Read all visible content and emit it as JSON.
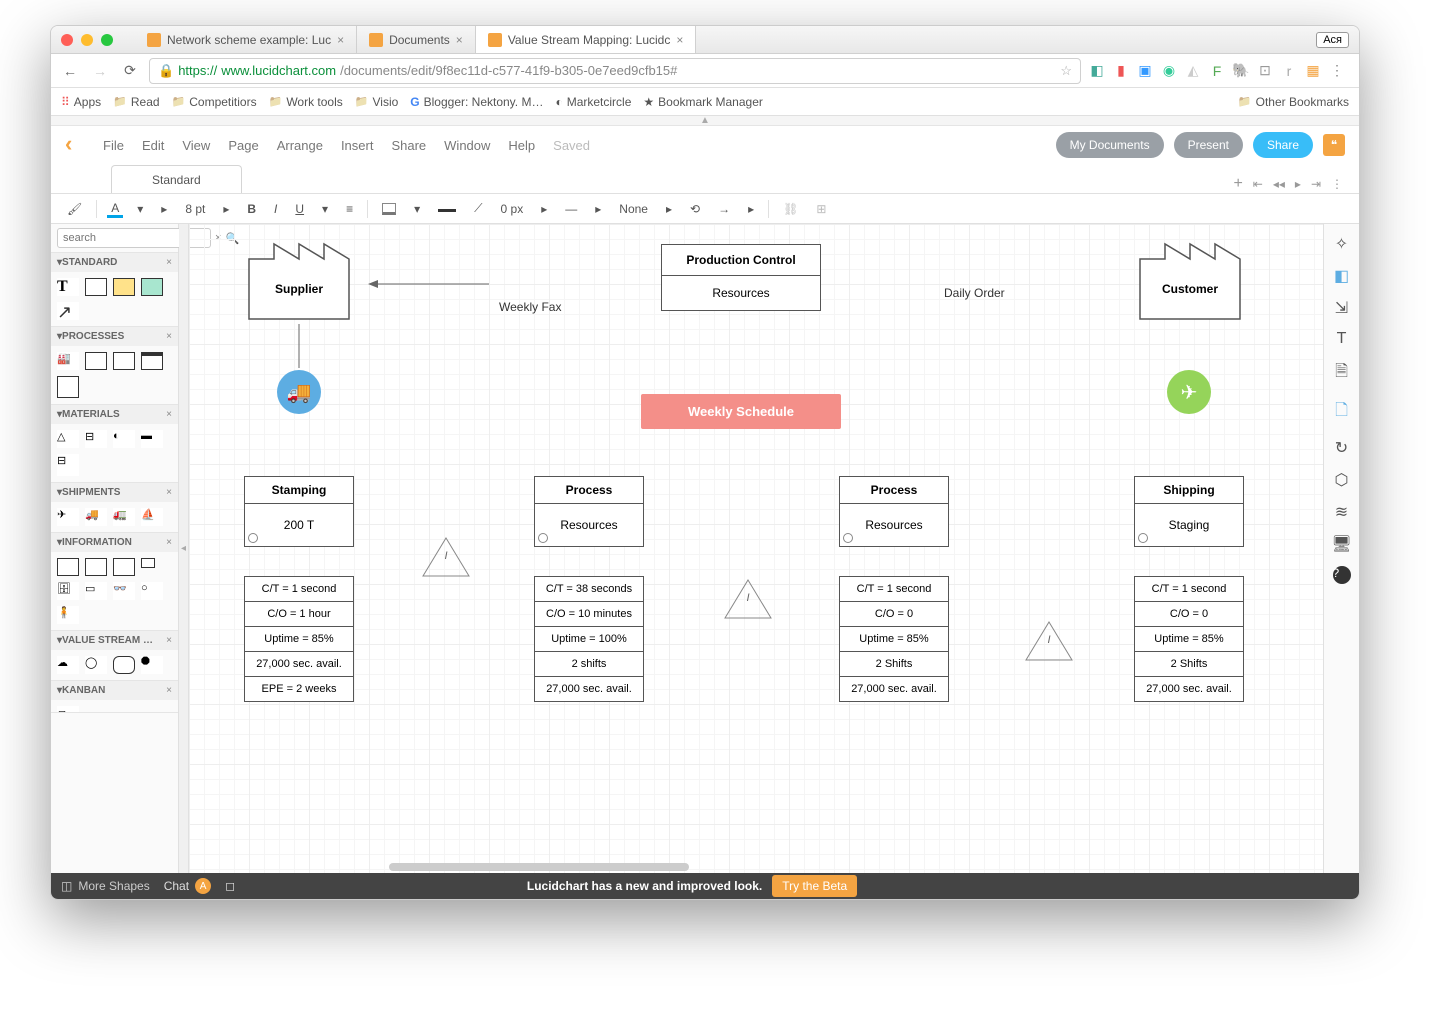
{
  "browser": {
    "tabs": [
      {
        "title": "Network scheme example: Luc"
      },
      {
        "title": "Documents"
      },
      {
        "title": "Value Stream Mapping: Lucidc"
      }
    ],
    "user_button": "Ася",
    "url_scheme": "https://",
    "url_domain": "www.lucidchart.com",
    "url_path": "/documents/edit/9f8ec11d-c577-41f9-b305-0e7eed9cfb15#",
    "bookmarks": [
      "Apps",
      "Read",
      "Competitiors",
      "Work tools",
      "Visio",
      "Blogger: Nektony. M…",
      "Marketcircle",
      "Bookmark Manager"
    ],
    "other_bookmarks": "Other Bookmarks"
  },
  "menu": {
    "items": [
      "File",
      "Edit",
      "View",
      "Page",
      "Arrange",
      "Insert",
      "Share",
      "Window",
      "Help"
    ],
    "status": "Saved",
    "buttons": {
      "docs": "My Documents",
      "present": "Present",
      "share": "Share"
    }
  },
  "doctab": {
    "label": "Standard"
  },
  "toolbar": {
    "font_size": "8 pt",
    "line_width": "0 px",
    "line_style": "None"
  },
  "left_panel": {
    "search_placeholder": "search",
    "sections": [
      "STANDARD",
      "PROCESSES",
      "MATERIALS",
      "SHIPMENTS",
      "INFORMATION",
      "VALUE STREAM …",
      "KANBAN"
    ],
    "more_shapes": "More Shapes"
  },
  "diagram": {
    "supplier": "Supplier",
    "customer": "Customer",
    "prod_control_hdr": "Production Control",
    "prod_control_body": "Resources",
    "schedule": "Weekly Schedule",
    "weekly_fax": "Weekly Fax",
    "daily_order": "Daily Order",
    "triangle_label": "I",
    "processes": [
      {
        "name": "Stamping",
        "body": "200 T",
        "data": [
          "C/T = 1 second",
          "C/O = 1 hour",
          "Uptime = 85%",
          "27,000 sec. avail.",
          "EPE = 2 weeks"
        ]
      },
      {
        "name": "Process",
        "body": "Resources",
        "data": [
          "C/T = 38 seconds",
          "C/O = 10 minutes",
          "Uptime = 100%",
          "2 shifts",
          "27,000 sec. avail."
        ]
      },
      {
        "name": "Process",
        "body": "Resources",
        "data": [
          "C/T = 1 second",
          "C/O = 0",
          "Uptime = 85%",
          "2 Shifts",
          "27,000 sec. avail."
        ]
      },
      {
        "name": "Shipping",
        "body": "Staging",
        "data": [
          "C/T = 1 second",
          "C/O = 0",
          "Uptime = 85%",
          "2 Shifts",
          "27,000 sec. avail."
        ]
      }
    ]
  },
  "footer": {
    "chat": "Chat",
    "chat_badge": "A",
    "banner_text": "Lucidchart has a new and improved look.",
    "banner_btn": "Try the Beta"
  }
}
